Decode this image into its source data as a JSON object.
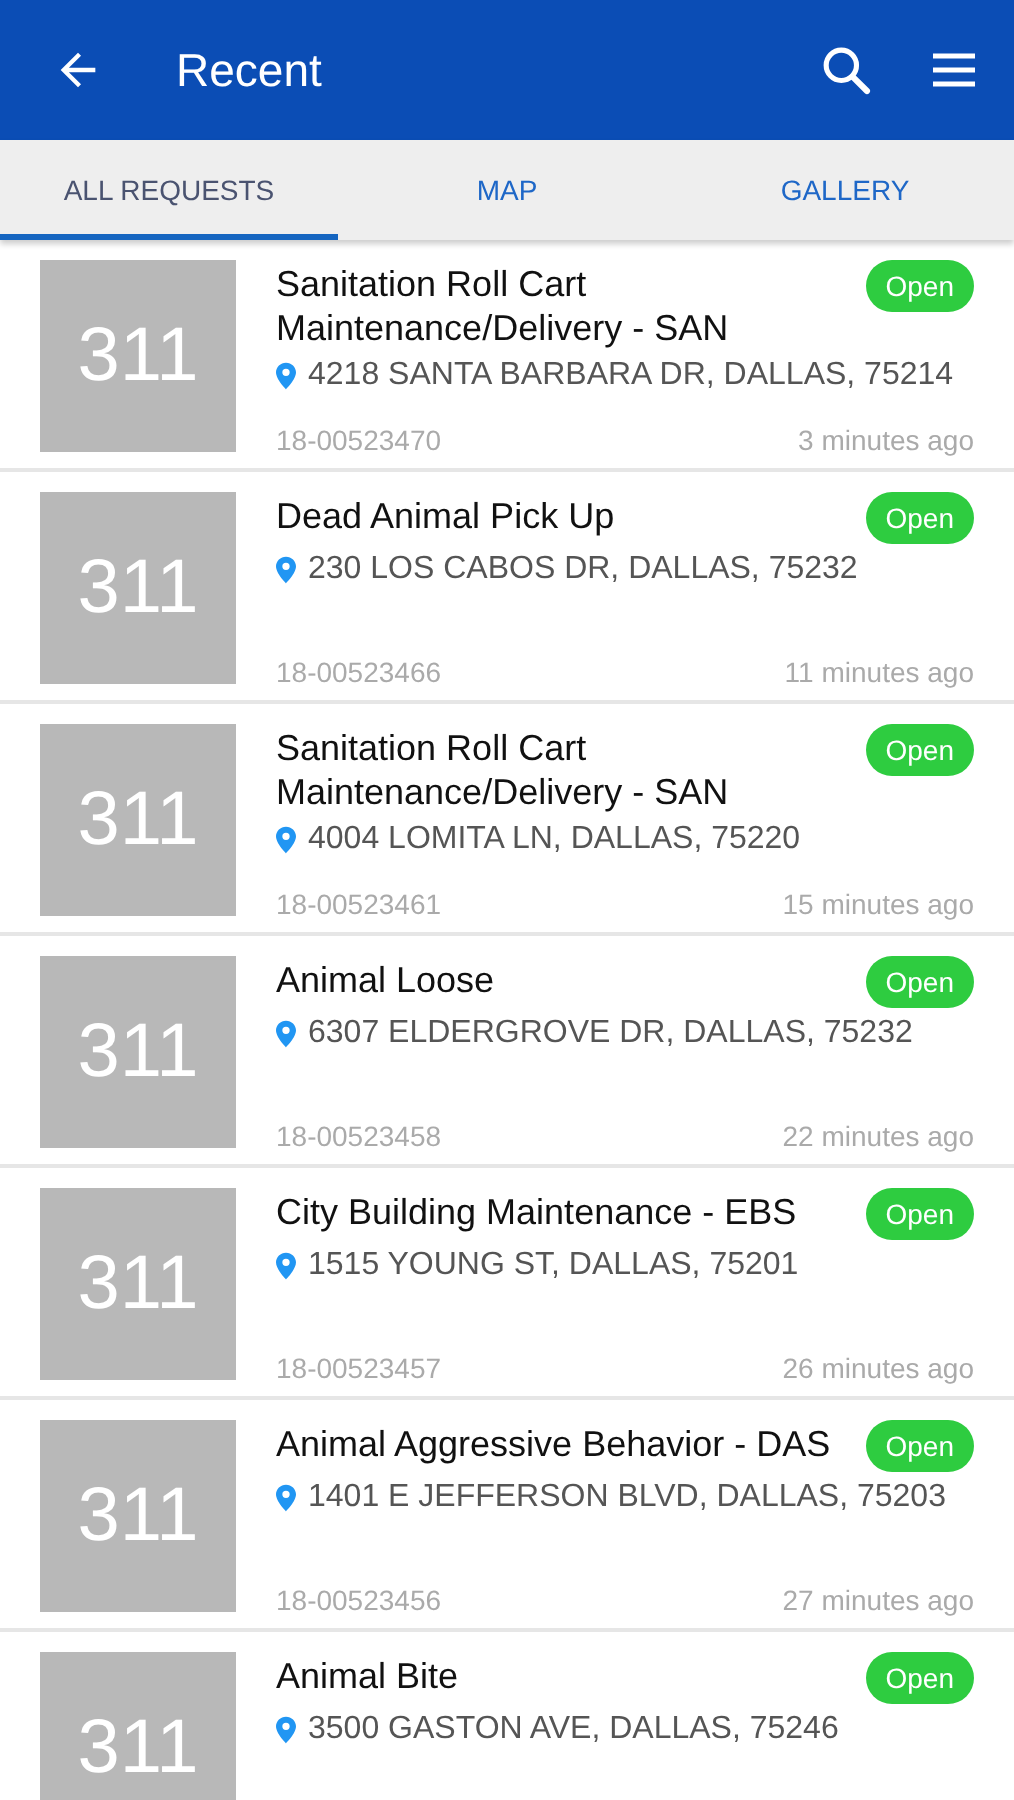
{
  "header": {
    "title": "Recent"
  },
  "tabs": [
    {
      "label": "ALL REQUESTS",
      "selected": true
    },
    {
      "label": "MAP",
      "selected": false
    },
    {
      "label": "GALLERY",
      "selected": false
    }
  ],
  "requests": [
    {
      "thumbnail": "311",
      "title": "Sanitation Roll Cart Maintenance/Delivery - SAN",
      "status": "Open",
      "address": "4218 SANTA BARBARA DR, DALLAS, 75214",
      "id": "18-00523470",
      "time": "3 minutes ago"
    },
    {
      "thumbnail": "311",
      "title": "Dead Animal Pick Up",
      "status": "Open",
      "address": "230 LOS CABOS DR, DALLAS, 75232",
      "id": "18-00523466",
      "time": "11 minutes ago"
    },
    {
      "thumbnail": "311",
      "title": "Sanitation Roll Cart Maintenance/Delivery - SAN",
      "status": "Open",
      "address": "4004 LOMITA LN, DALLAS, 75220",
      "id": "18-00523461",
      "time": "15 minutes ago"
    },
    {
      "thumbnail": "311",
      "title": "Animal Loose",
      "status": "Open",
      "address": "6307 ELDERGROVE DR, DALLAS, 75232",
      "id": "18-00523458",
      "time": "22 minutes ago"
    },
    {
      "thumbnail": "311",
      "title": "City Building Maintenance - EBS",
      "status": "Open",
      "address": "1515 YOUNG ST, DALLAS, 75201",
      "id": "18-00523457",
      "time": "26 minutes ago"
    },
    {
      "thumbnail": "311",
      "title": "Animal Aggressive Behavior - DAS",
      "status": "Open",
      "address": "1401 E JEFFERSON BLVD, DALLAS, 75203",
      "id": "18-00523456",
      "time": "27 minutes ago"
    },
    {
      "thumbnail": "311",
      "title": "Animal Bite",
      "status": "Open",
      "address": "3500 GASTON AVE, DALLAS, 75246"
    }
  ]
}
